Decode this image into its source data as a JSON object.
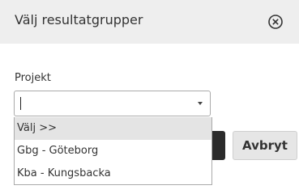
{
  "dialog": {
    "title": "Välj resultatgrupper",
    "close_icon": "close-circle-icon"
  },
  "form": {
    "project_label": "Projekt",
    "project_select_value": "",
    "dropdown_arrow_icon": "chevron-down-icon",
    "options": [
      {
        "label": "Välj >>",
        "highlighted": true
      },
      {
        "label": "Gbg - Göteborg",
        "highlighted": false
      },
      {
        "label": "Kba - Kungsbacka",
        "highlighted": false
      }
    ]
  },
  "buttons": {
    "cancel_label": "Avbryt"
  },
  "colors": {
    "header_bg": "#eeeeee",
    "primary_button": "#2b2b2b",
    "cancel_button_bg": "#e6e6e6",
    "highlight_bg": "#e4e4e4"
  }
}
